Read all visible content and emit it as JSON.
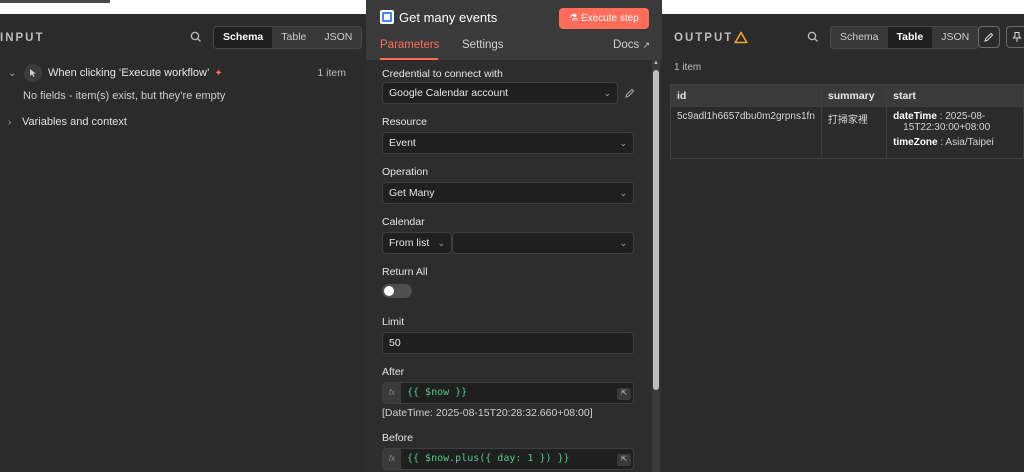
{
  "input": {
    "title": "INPUT",
    "tabs": [
      "Schema",
      "Table",
      "JSON"
    ],
    "active_tab": "Schema",
    "trigger_name": "When clicking ‘Execute workflow’",
    "item_count": "1 item",
    "empty_message": "No fields - item(s) exist, but they’re empty",
    "variables_label": "Variables and context"
  },
  "node": {
    "title": "Get many events",
    "execute_label": "Execute step",
    "tabs": {
      "parameters": "Parameters",
      "settings": "Settings",
      "docs": "Docs"
    },
    "fields": {
      "credential_label": "Credential to connect with",
      "credential_value": "Google Calendar account",
      "resource_label": "Resource",
      "resource_value": "Event",
      "operation_label": "Operation",
      "operation_value": "Get Many",
      "calendar_label": "Calendar",
      "calendar_mode": "From list",
      "return_all_label": "Return All",
      "limit_label": "Limit",
      "limit_value": "50",
      "after_label": "After",
      "after_expr": "{{ $now }}",
      "after_hint": "[DateTime: 2025-08-15T20:28:32.660+08:00]",
      "before_label": "Before",
      "before_expr": "{{ $now.plus({ day: 1 }) }}",
      "fx": "fx"
    }
  },
  "output": {
    "title": "OUTPUT",
    "tabs": [
      "Schema",
      "Table",
      "JSON"
    ],
    "active_tab": "Table",
    "item_count": "1 item",
    "columns": [
      "id",
      "summary",
      "start"
    ],
    "row": {
      "id": "5c9adl1h6657dbu0m2grpns1fn",
      "summary": "打掃家裡",
      "start_datetime_key": "dateTime",
      "start_datetime_value_1": ": 2025-08-",
      "start_datetime_value_2": "15T22:30:00+08:00",
      "start_timezone_key": "timeZone",
      "start_timezone_value": ": Asia/Taipei"
    }
  },
  "colors": {
    "accent": "#ff6d5a",
    "warning": "#f5a623",
    "expression": "#52c98a"
  }
}
